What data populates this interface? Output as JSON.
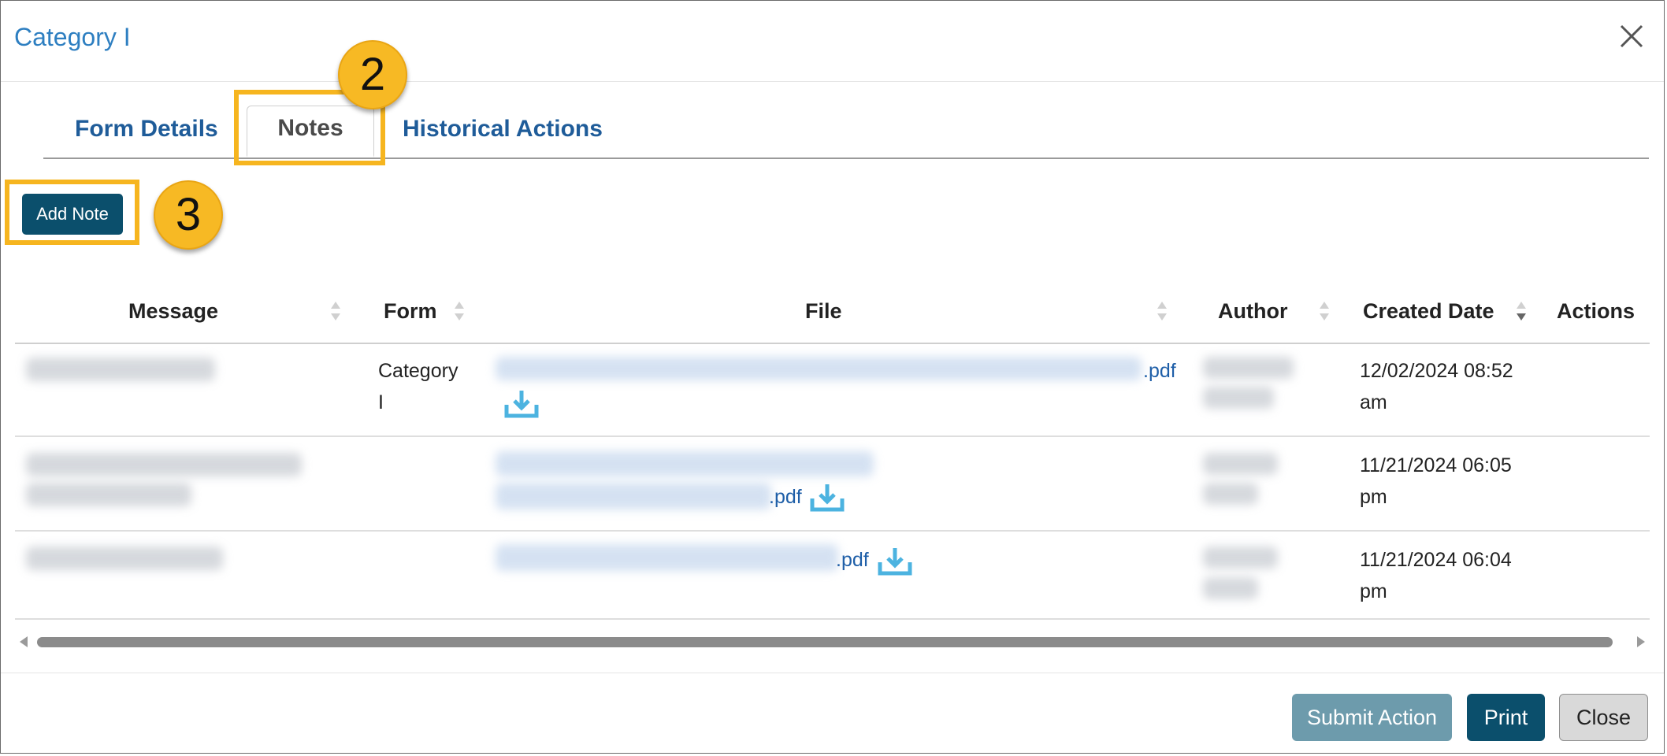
{
  "dialog": {
    "title": "Category I"
  },
  "tabs": [
    {
      "label": "Form Details"
    },
    {
      "label": "Notes"
    },
    {
      "label": "Historical Actions"
    }
  ],
  "active_tab": "Notes",
  "callouts": [
    "2",
    "3"
  ],
  "toolbar": {
    "add_note_label": "Add Note"
  },
  "table": {
    "columns": [
      "Message",
      "Form",
      "File",
      "Author",
      "Created Date",
      "Actions"
    ],
    "sorted_column": "Created Date",
    "sort_direction": "descending",
    "rows": [
      {
        "form_line1": "Category",
        "form_line2": "I",
        "file_ext": ".pdf",
        "date_line1": "12/02/2024 08:52",
        "date_line2": "am"
      },
      {
        "form_line1": "",
        "form_line2": "",
        "file_ext": ".pdf",
        "date_line1": "11/21/2024 06:05",
        "date_line2": "pm"
      },
      {
        "form_line1": "",
        "form_line2": "",
        "file_ext": ".pdf",
        "date_line1": "11/21/2024 06:04",
        "date_line2": "pm"
      }
    ]
  },
  "footer": {
    "submit_label": "Submit Action",
    "print_label": "Print",
    "close_label": "Close"
  },
  "colors": {
    "highlight": "#f6b51f",
    "primary": "#0b4f6c",
    "link": "#1f5fa8",
    "download_icon": "#4cb3e0"
  }
}
